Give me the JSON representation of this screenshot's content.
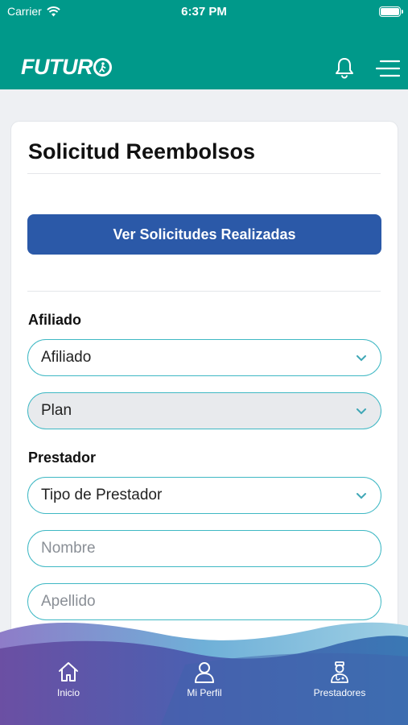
{
  "status": {
    "carrier": "Carrier",
    "time": "6:37 PM"
  },
  "header": {
    "logo_text": "FUTUR",
    "icons": [
      "bell-icon",
      "hamburger-menu-icon"
    ]
  },
  "colors": {
    "header": "#00998a",
    "primary": "#2b59a8",
    "field_border": "#3fb8c4"
  },
  "page": {
    "title": "Solicitud Reembolsos",
    "primary_button": "Ver Solicitudes Realizadas"
  },
  "afiliado": {
    "label": "Afiliado",
    "select_value": "Afiliado",
    "plan_value": "Plan"
  },
  "prestador": {
    "label": "Prestador",
    "tipo_value": "Tipo de Prestador",
    "nombre_placeholder": "Nombre",
    "apellido_placeholder": "Apellido"
  },
  "nav": {
    "items": [
      {
        "label": "Inicio",
        "icon": "home-icon"
      },
      {
        "label": "Mi Perfil",
        "icon": "user-icon"
      },
      {
        "label": "Prestadores",
        "icon": "doctor-icon"
      }
    ]
  }
}
